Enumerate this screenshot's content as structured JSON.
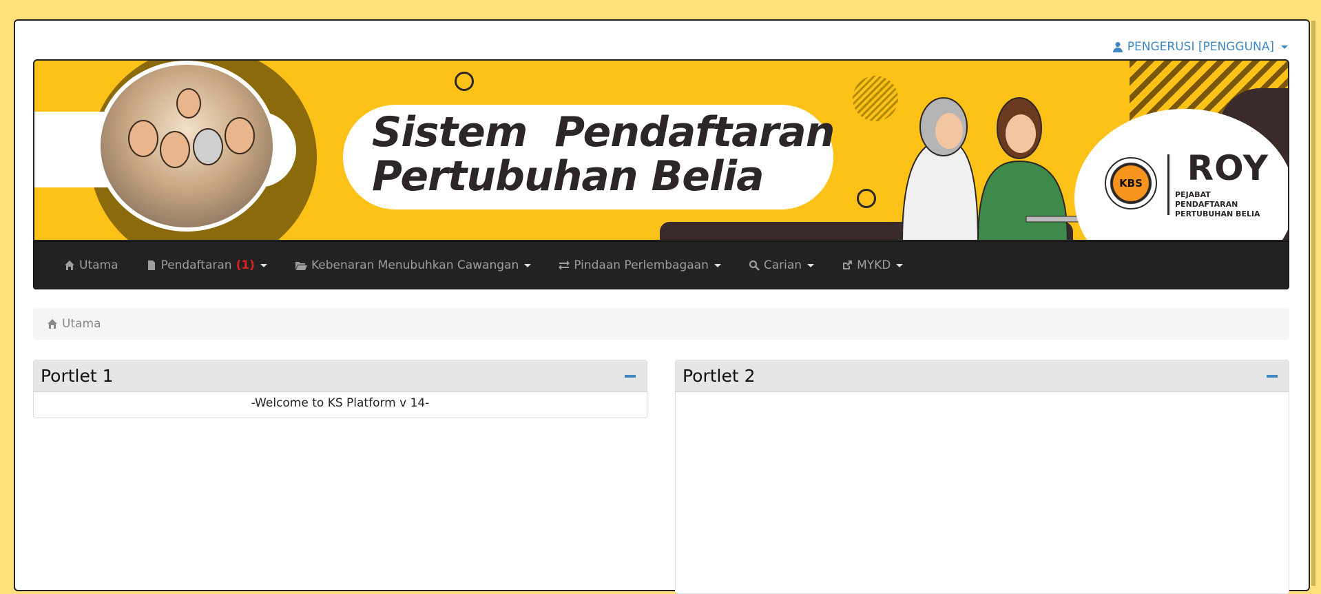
{
  "user_menu": {
    "label": "PENGERUSI [PENGGUNA]",
    "icon": "user-icon"
  },
  "banner": {
    "title_line1": "Sistem  Pendaftaran",
    "title_line2": "Pertubuhan Belia",
    "badge_text": "KBS",
    "logo_text": "ROY",
    "logo_sub_line1": "PEJABAT PENDAFTARAN",
    "logo_sub_line2": "PERTUBUHAN BELIA",
    "colors": {
      "background": "#fdc218",
      "dark": "#2d2626",
      "badge_orange": "#f7941d"
    }
  },
  "navbar": {
    "items": [
      {
        "label": "Utama",
        "icon": "home-icon",
        "dropdown": false
      },
      {
        "label": "Pendaftaran",
        "badge": "(1)",
        "icon": "file-icon",
        "dropdown": true
      },
      {
        "label": "Kebenaran Menubuhkan Cawangan",
        "icon": "folder-open-icon",
        "dropdown": true
      },
      {
        "label": "Pindaan Perlembagaan",
        "icon": "transfer-icon",
        "dropdown": true
      },
      {
        "label": "Carian",
        "icon": "search-icon",
        "dropdown": true
      },
      {
        "label": "MYKD",
        "icon": "external-link-icon",
        "dropdown": true
      }
    ],
    "colors": {
      "background": "#222222",
      "text": "#9d9d9d",
      "badge": "#e02020"
    }
  },
  "breadcrumb": {
    "label": "Utama",
    "icon": "home-icon"
  },
  "portlets": [
    {
      "title": "Portlet 1",
      "body": "-Welcome to KS Platform v 14-"
    },
    {
      "title": "Portlet 2",
      "body": ""
    }
  ],
  "colors": {
    "page_background": "#ffe07a",
    "accent": "#3f88c5"
  }
}
